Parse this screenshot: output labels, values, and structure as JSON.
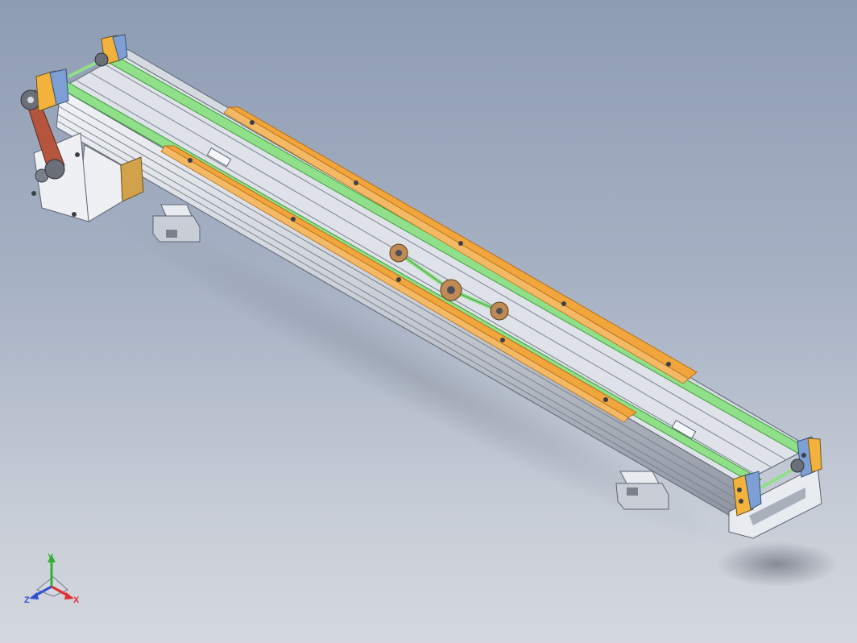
{
  "viewport": {
    "background_top": "#8e9cb3",
    "background_bottom": "#d4d8de"
  },
  "model": {
    "colors": {
      "frame_light": "#e4e8ee",
      "frame_mid": "#b8bec8",
      "frame_dark": "#6f7684",
      "belt": "#8fe089",
      "belt_dark": "#3f9a3f",
      "guide_strip": "#f0a63c",
      "guide_strip_dark": "#b86e18",
      "bracket_yellow": "#f2b23b",
      "bracket_blue": "#7d9fd4",
      "motor_belt": "#b5553d",
      "roller": "#c08a55"
    }
  },
  "triad": {
    "x_label": "X",
    "y_label": "Y",
    "z_label": "Z",
    "x_color": "#e03030",
    "y_color": "#30b030",
    "z_color": "#3050d0"
  }
}
